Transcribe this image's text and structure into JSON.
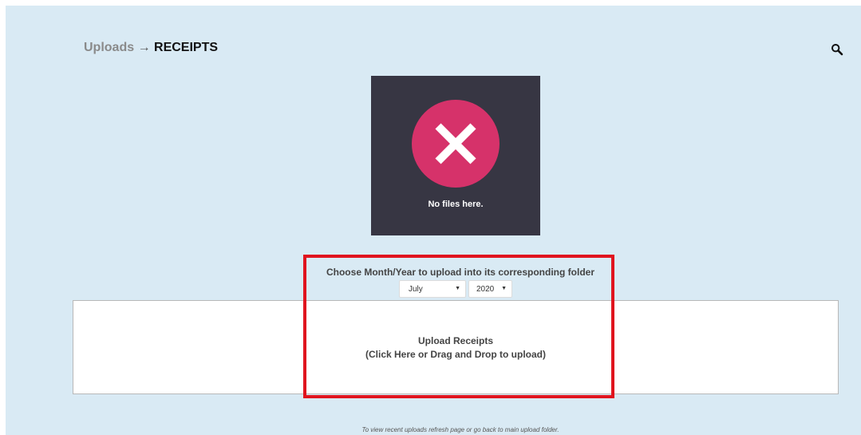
{
  "breadcrumb": {
    "parent": "Uploads",
    "separator": " → ",
    "current": "RECEIPTS"
  },
  "header": {
    "search_icon": "magnifier-icon"
  },
  "empty_state": {
    "icon": "x-circle-icon",
    "message": "No files here."
  },
  "upload_options": {
    "label": "Choose Month/Year to upload into its corresponding folder",
    "month": "July",
    "year": "2020"
  },
  "dropzone": {
    "title": "Upload Receipts",
    "subtitle": "(Click Here or Drag and Drop to upload)"
  },
  "footer": {
    "note": "To view recent uploads refresh page or go back to main upload folder."
  },
  "colors": {
    "page_background": "#d9eaf4",
    "panel_background": "#373643",
    "icon_accent": "#d6326a",
    "highlight_border": "#e0141e"
  }
}
